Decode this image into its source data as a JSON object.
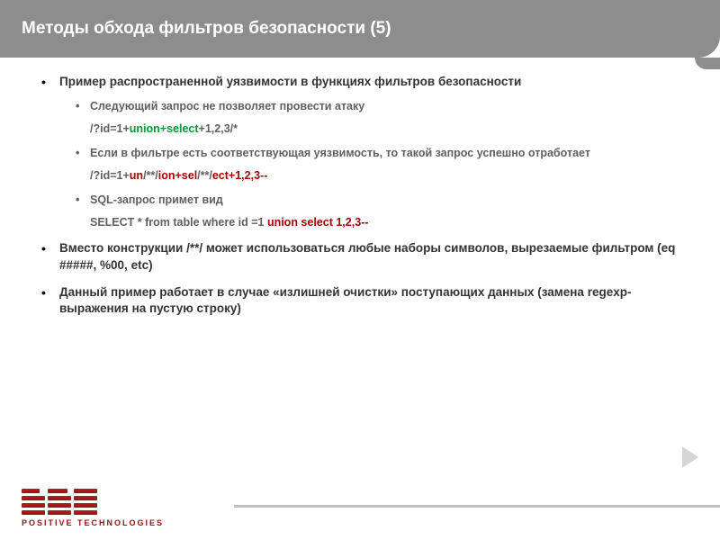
{
  "title": "Методы обхода фильтров безопасности (5)",
  "bullets": {
    "b1": "Пример распространенной уязвимости в функциях фильтров безопасности",
    "b1_1": "Следующий запрос не позволяет провести атаку",
    "code1_pre": "/?id=1+",
    "code1_kw": "union+select",
    "code1_post": "+1,2,3/*",
    "b1_2": "Если в фильтре есть соответствующая уязвимость, то такой запрос успешно отработает",
    "code2_p1": "/?id=1+",
    "code2_r1": "un",
    "code2_p2": "/**/",
    "code2_r2": "ion+sel",
    "code2_p3": "/**/",
    "code2_r3": "ect+1,2,3--",
    "b1_3": "SQL-запрос примет вид",
    "code3_pre": "SELECT * from table where id =1 ",
    "code3_kw": "union select 1,2,3--",
    "b2": "Вместо конструкции /**/ может использоваться любые наборы символов, вырезаемые фильтром (eq #####, %00, etc)",
    "b3": "Данный пример работает в случае «излишней очистки» поступающих данных (замена regexp-выражения на пустую строку)"
  },
  "logo_text": "POSITIVE TECHNOLOGIES"
}
